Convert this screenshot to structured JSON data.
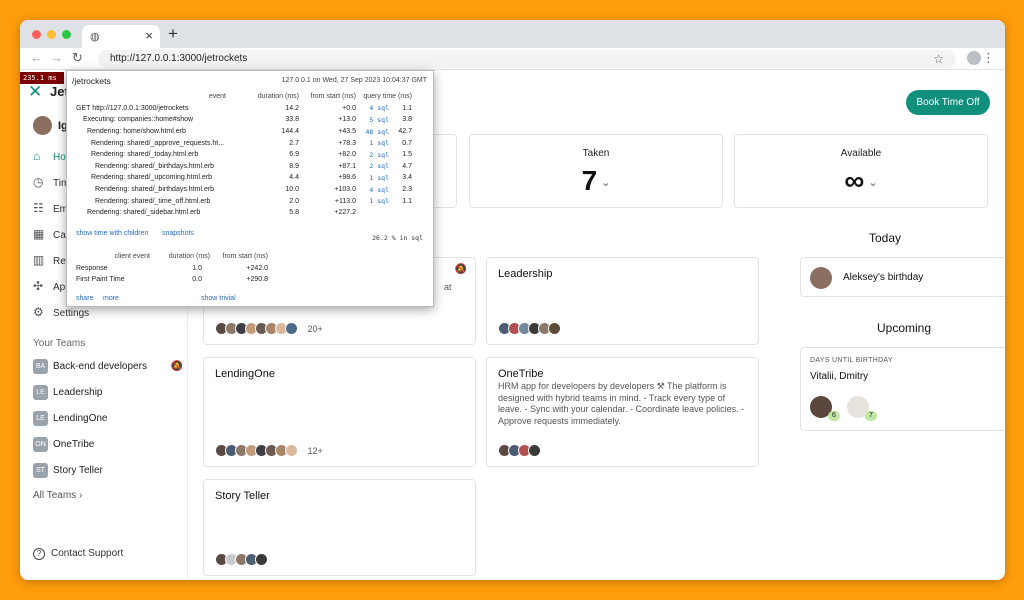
{
  "browser": {
    "url": "http://127.0.0.1:3000/jetrockets"
  },
  "app": {
    "logo_text": "Jet",
    "user_name": "Ig",
    "sidebar": [
      {
        "label": "Home",
        "icon": "home-icon",
        "active": true
      },
      {
        "label": "Time",
        "icon": "clock-icon"
      },
      {
        "label": "Employees",
        "icon": "people-icon"
      },
      {
        "label": "Calendar",
        "icon": "calendar-icon"
      },
      {
        "label": "Reports",
        "icon": "chart-icon"
      },
      {
        "label": "Apps",
        "icon": "puzzle-icon"
      },
      {
        "label": "Settings",
        "icon": "gear-icon"
      }
    ],
    "your_teams_label": "Your Teams",
    "teams": [
      {
        "badge": "BA",
        "name": "Back-end developers",
        "muted": true
      },
      {
        "badge": "LE",
        "name": "Leadership"
      },
      {
        "badge": "LE",
        "name": "LendingOne"
      },
      {
        "badge": "ON",
        "name": "OneTribe"
      },
      {
        "badge": "ST",
        "name": "Story Teller"
      }
    ],
    "all_teams_label": "All Teams",
    "contact_support": "Contact Support"
  },
  "main": {
    "book_button": "Book Time Off",
    "stats": [
      {
        "label": "Taken",
        "value": "7"
      },
      {
        "label": "Available",
        "value": "∞"
      }
    ],
    "team_cards": [
      {
        "title": "",
        "desc": "at",
        "more": "20+"
      },
      {
        "title": "Leadership",
        "desc": "",
        "more": ""
      },
      {
        "title": "LendingOne",
        "desc": "",
        "more": "12+"
      },
      {
        "title": "OneTribe",
        "desc": "HRM app for developers by developers ⚒ The platform is designed with hybrid teams in mind. - Track every type of leave. - Sync with your calendar. - Coordinate leave policies. - Approve requests immediately.",
        "more": ""
      },
      {
        "title": "Story Teller",
        "desc": "",
        "more": ""
      }
    ],
    "today_title": "Today",
    "today_item": "Aleksey's birthday",
    "upcoming_title": "Upcoming",
    "upcoming_label": "DAYS UNTIL BIRTHDAY",
    "upcoming_names": "Vitalii, Dmitry",
    "upcoming_days": [
      "6",
      "7"
    ]
  },
  "profiler": {
    "badge": "235.1 ms",
    "path": "/jetrockets",
    "server_info": "127.0.0.1 on Wed, 27 Sep 2023 10:04:37 GMT",
    "headers": [
      "event",
      "duration (ms)",
      "from start (ms)",
      "query time (ms)"
    ],
    "rows": [
      {
        "name": "GET http://127.0.0.1:3000/jetrockets",
        "duration": "14.2",
        "start": "+0.0",
        "sql": "4 sql",
        "qt": "1.1"
      },
      {
        "name": "Executing: companies::home#show",
        "duration": "33.8",
        "start": "+13.0",
        "sql": "5 sql",
        "qt": "3.8"
      },
      {
        "name": "Rendering: home/show.html.erb",
        "duration": "144.4",
        "start": "+43.5",
        "sql": "48 sql",
        "qt": "42.7"
      },
      {
        "name": "Rendering: shared/_approve_requests.ht...",
        "duration": "2.7",
        "start": "+78.3",
        "sql": "1 sql",
        "qt": "0.7"
      },
      {
        "name": "Rendering: shared/_today.html.erb",
        "duration": "6.9",
        "start": "+82.0",
        "sql": "2 sql",
        "qt": "1.5"
      },
      {
        "name": "Rendering: shared/_birthdays.html.erb",
        "duration": "8.9",
        "start": "+87.1",
        "sql": "2 sql",
        "qt": "4.7"
      },
      {
        "name": "Rendering: shared/_upcoming.html.erb",
        "duration": "4.4",
        "start": "+98.6",
        "sql": "1 sql",
        "qt": "3.4"
      },
      {
        "name": "Rendering: shared/_birthdays.html.erb",
        "duration": "10.0",
        "start": "+103.0",
        "sql": "4 sql",
        "qt": "2.3"
      },
      {
        "name": "Rendering: shared/_time_off.html.erb",
        "duration": "2.0",
        "start": "+113.0",
        "sql": "1 sql",
        "qt": "1.1"
      },
      {
        "name": "Rendering: shared/_sidebar.html.erb",
        "duration": "5.8",
        "start": "+227.2",
        "sql": "",
        "qt": ""
      }
    ],
    "show_children": "show time with children",
    "snapshots": "snapshots",
    "sql_pct": "26.2 % in sql",
    "client_headers": [
      "client event",
      "duration (ms)",
      "from start (ms)"
    ],
    "client_rows": [
      {
        "name": "Response",
        "duration": "1.0",
        "start": "+242.0"
      },
      {
        "name": "First Paint Time",
        "duration": "0.0",
        "start": "+290.8"
      }
    ],
    "share": "share",
    "more": "more",
    "show_trivial": "show trivial"
  },
  "colors": {
    "accent": "#0f8f7c",
    "background": "#ff9d0a",
    "profiler_badge": "#7a0000"
  }
}
